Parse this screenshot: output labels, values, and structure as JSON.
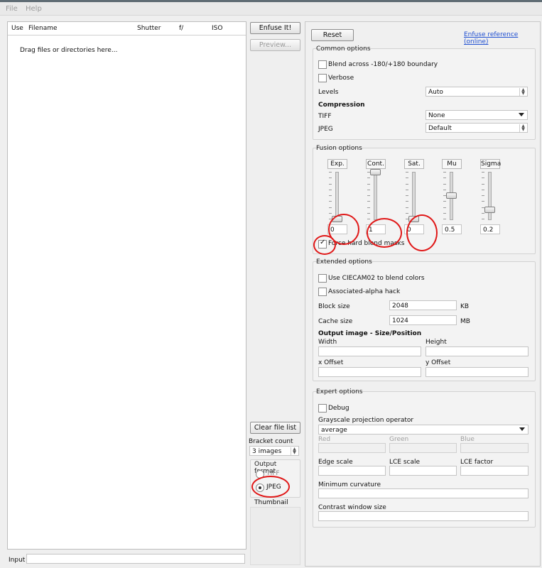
{
  "menu": {
    "file": "File",
    "help": "Help"
  },
  "file_table": {
    "columns": [
      "Use",
      "Filename",
      "Shutter",
      "f/",
      "ISO"
    ],
    "placeholder": "Drag files or directories here..."
  },
  "buttons": {
    "enfuse": "Enfuse It!",
    "preview": "Preview...",
    "reset": "Reset",
    "clear_list": "Clear file list"
  },
  "link": "Enfuse reference (online)",
  "common": {
    "title": "Common options",
    "blend_across": "Blend across -180/+180 boundary",
    "verbose": "Verbose",
    "levels_label": "Levels",
    "levels_value": "Auto",
    "compression_title": "Compression",
    "tiff_label": "TIFF",
    "tiff_value": "None",
    "jpeg_label": "JPEG",
    "jpeg_value": "Default"
  },
  "fusion": {
    "title": "Fusion options",
    "sliders": [
      {
        "label": "Exp.",
        "value": "0",
        "level": 0.0
      },
      {
        "label": "Cont.",
        "value": "1",
        "level": 1.0
      },
      {
        "label": "Sat.",
        "value": "0",
        "level": 0.0
      },
      {
        "label": "Mu",
        "value": "0.5",
        "level": 0.5
      },
      {
        "label": "Sigma",
        "value": "0.2",
        "level": 0.2
      }
    ],
    "hard_masks": "Force hard blend masks"
  },
  "extended": {
    "title": "Extended options",
    "ciecam": "Use CIECAM02 to blend colors",
    "alpha": "Associated-alpha hack",
    "block_label": "Block size",
    "block_value": "2048",
    "block_unit": "KB",
    "cache_label": "Cache size",
    "cache_value": "1024",
    "cache_unit": "MB",
    "output_title": "Output image - Size/Position",
    "width": "Width",
    "height": "Height",
    "xoff": "x Offset",
    "yoff": "y Offset"
  },
  "expert": {
    "title": "Expert options",
    "debug": "Debug",
    "gray_label": "Grayscale projection operator",
    "gray_value": "average",
    "red": "Red",
    "green": "Green",
    "blue": "Blue",
    "edge": "Edge scale",
    "lce": "LCE scale",
    "lcef": "LCE factor",
    "mincurv": "Minimum curvature",
    "contrast": "Contrast window size"
  },
  "bracket": {
    "label": "Bracket count",
    "value": "3 images"
  },
  "output_format": {
    "title": "Output format",
    "tiff": "TIFF",
    "jpeg": "JPEG",
    "selected": "JPEG"
  },
  "thumbnail": "Thumbnail",
  "input_label": "Input",
  "colors": {
    "link": "#1f4fd1",
    "annotation": "#e01818"
  }
}
